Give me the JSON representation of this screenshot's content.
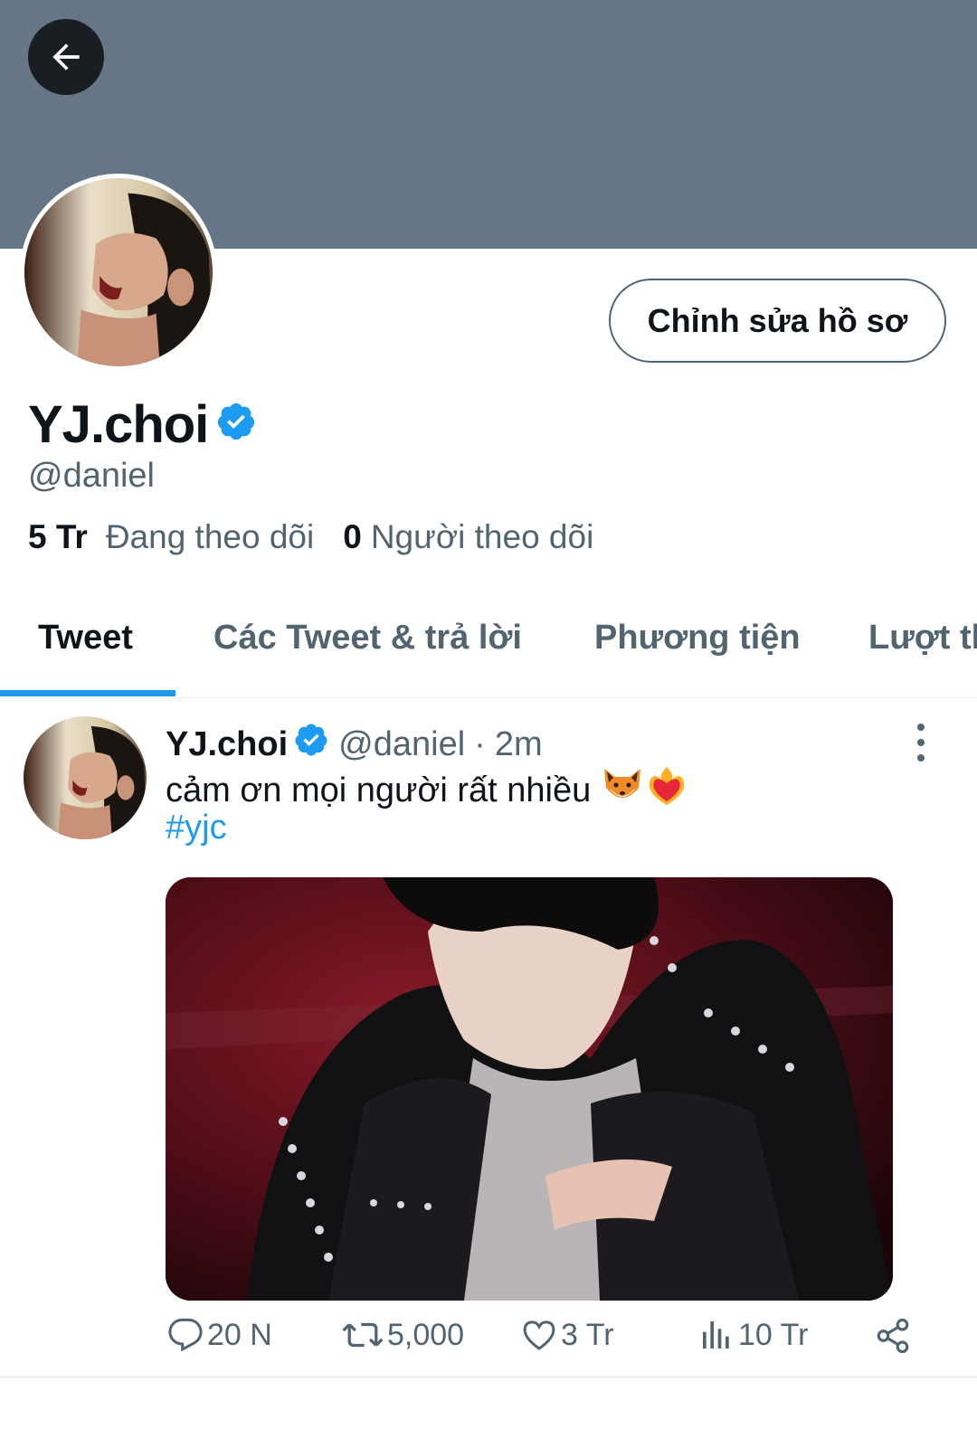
{
  "header": {
    "back_icon": "arrow-left-icon",
    "banner_color": "#657786"
  },
  "profile": {
    "display_name": "YJ.choi",
    "handle": "@daniel",
    "verified": true,
    "edit_button_label": "Chỉnh sửa hồ sơ",
    "following_count": "5 Tr",
    "following_label": "Đang theo dõi",
    "followers_count": "0",
    "followers_label": "Người theo dõi"
  },
  "tabs": [
    {
      "label": "Tweet",
      "active": true
    },
    {
      "label": "Các Tweet & trả lời",
      "active": false
    },
    {
      "label": "Phương tiện",
      "active": false
    },
    {
      "label": "Lượt thích",
      "active": false
    }
  ],
  "tweet": {
    "author_name": "YJ.choi",
    "author_handle": "@daniel",
    "separator": "·",
    "time": "2m",
    "text": "cảm ơn mọi người rất nhiều",
    "emojis": [
      "fox-emoji",
      "heart-on-fire-emoji"
    ],
    "hashtag": "#yjc",
    "more_icon": "more-vertical-icon",
    "actions": {
      "replies": "20 N",
      "retweets": "5,000",
      "likes": "3 Tr",
      "views": "10 Tr"
    }
  },
  "colors": {
    "accent": "#1d9bf0",
    "secondary_text": "#536471",
    "primary_text": "#0f1419"
  }
}
